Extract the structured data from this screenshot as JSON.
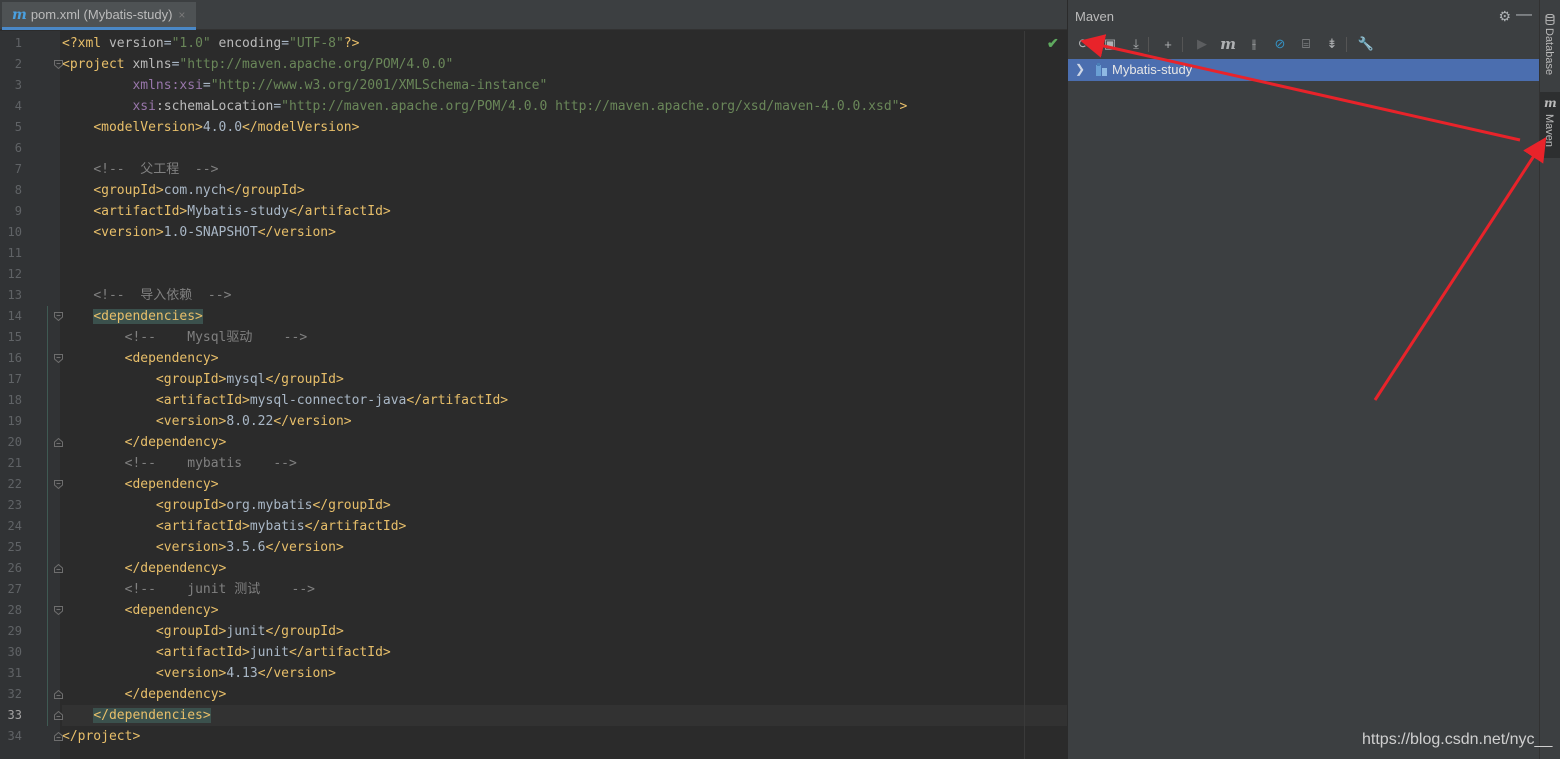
{
  "editor": {
    "tab": {
      "icon": "maven-m-icon",
      "label": "pom.xml (Mybatis-study)",
      "close": "×"
    },
    "current_line": 33,
    "lines": [
      [
        [
          "pi",
          "<?xml "
        ],
        [
          "at",
          "version"
        ],
        [
          "txt",
          "="
        ],
        [
          "av",
          "\"1.0\""
        ],
        [
          "at",
          " encoding"
        ],
        [
          "txt",
          "="
        ],
        [
          "av",
          "\"UTF-8\""
        ],
        [
          "pi",
          "?>"
        ]
      ],
      [
        [
          "tg",
          "<project "
        ],
        [
          "at",
          "xmlns"
        ],
        [
          "txt",
          "="
        ],
        [
          "av",
          "\"http://maven.apache.org/POM/4.0.0\""
        ]
      ],
      [
        [
          "txt",
          "         "
        ],
        [
          "ns",
          "xmlns:xsi"
        ],
        [
          "txt",
          "="
        ],
        [
          "av",
          "\"http://www.w3.org/2001/XMLSchema-instance\""
        ]
      ],
      [
        [
          "txt",
          "         "
        ],
        [
          "ns",
          "xsi"
        ],
        [
          "at",
          ":schemaLocation"
        ],
        [
          "txt",
          "="
        ],
        [
          "av",
          "\"http://maven.apache.org/POM/4.0.0 http://maven.apache.org/xsd/maven-4.0.0.xsd\""
        ],
        [
          "tg",
          ">"
        ]
      ],
      [
        [
          "txt",
          "    "
        ],
        [
          "tg",
          "<modelVersion>"
        ],
        [
          "txt",
          "4.0.0"
        ],
        [
          "tg",
          "</modelVersion>"
        ]
      ],
      [],
      [
        [
          "txt",
          "    "
        ],
        [
          "cm",
          "<!--  父工程  -->"
        ]
      ],
      [
        [
          "txt",
          "    "
        ],
        [
          "tg",
          "<groupId>"
        ],
        [
          "txt",
          "com.nych"
        ],
        [
          "tg",
          "</groupId>"
        ]
      ],
      [
        [
          "txt",
          "    "
        ],
        [
          "tg",
          "<artifactId>"
        ],
        [
          "txt",
          "Mybatis-study"
        ],
        [
          "tg",
          "</artifactId>"
        ]
      ],
      [
        [
          "txt",
          "    "
        ],
        [
          "tg",
          "<version>"
        ],
        [
          "txt",
          "1.0-SNAPSHOT"
        ],
        [
          "tg",
          "</version>"
        ]
      ],
      [],
      [],
      [
        [
          "txt",
          "    "
        ],
        [
          "cm",
          "<!--  导入依赖  -->"
        ]
      ],
      [
        [
          "txt",
          "    "
        ],
        [
          "tg hl",
          "<dependencies>"
        ]
      ],
      [
        [
          "txt",
          "        "
        ],
        [
          "cm",
          "<!--    Mysql驱动    -->"
        ]
      ],
      [
        [
          "txt",
          "        "
        ],
        [
          "tg",
          "<dependency>"
        ]
      ],
      [
        [
          "txt",
          "            "
        ],
        [
          "tg",
          "<groupId>"
        ],
        [
          "txt",
          "mysql"
        ],
        [
          "tg",
          "</groupId>"
        ]
      ],
      [
        [
          "txt",
          "            "
        ],
        [
          "tg",
          "<artifactId>"
        ],
        [
          "txt",
          "mysql-connector-java"
        ],
        [
          "tg",
          "</artifactId>"
        ]
      ],
      [
        [
          "txt",
          "            "
        ],
        [
          "tg",
          "<version>"
        ],
        [
          "txt",
          "8.0.22"
        ],
        [
          "tg",
          "</version>"
        ]
      ],
      [
        [
          "txt",
          "        "
        ],
        [
          "tg",
          "</dependency>"
        ]
      ],
      [
        [
          "txt",
          "        "
        ],
        [
          "cm",
          "<!--    mybatis    -->"
        ]
      ],
      [
        [
          "txt",
          "        "
        ],
        [
          "tg",
          "<dependency>"
        ]
      ],
      [
        [
          "txt",
          "            "
        ],
        [
          "tg",
          "<groupId>"
        ],
        [
          "txt",
          "org.mybatis"
        ],
        [
          "tg",
          "</groupId>"
        ]
      ],
      [
        [
          "txt",
          "            "
        ],
        [
          "tg",
          "<artifactId>"
        ],
        [
          "txt",
          "mybatis"
        ],
        [
          "tg",
          "</artifactId>"
        ]
      ],
      [
        [
          "txt",
          "            "
        ],
        [
          "tg",
          "<version>"
        ],
        [
          "txt",
          "3.5.6"
        ],
        [
          "tg",
          "</version>"
        ]
      ],
      [
        [
          "txt",
          "        "
        ],
        [
          "tg",
          "</dependency>"
        ]
      ],
      [
        [
          "txt",
          "        "
        ],
        [
          "cm",
          "<!--    junit 测试    -->"
        ]
      ],
      [
        [
          "txt",
          "        "
        ],
        [
          "tg",
          "<dependency>"
        ]
      ],
      [
        [
          "txt",
          "            "
        ],
        [
          "tg",
          "<groupId>"
        ],
        [
          "txt",
          "junit"
        ],
        [
          "tg",
          "</groupId>"
        ]
      ],
      [
        [
          "txt",
          "            "
        ],
        [
          "tg",
          "<artifactId>"
        ],
        [
          "txt",
          "junit"
        ],
        [
          "tg",
          "</artifactId>"
        ]
      ],
      [
        [
          "txt",
          "            "
        ],
        [
          "tg",
          "<version>"
        ],
        [
          "txt",
          "4.13"
        ],
        [
          "tg",
          "</version>"
        ]
      ],
      [
        [
          "txt",
          "        "
        ],
        [
          "tg",
          "</dependency>"
        ]
      ],
      [
        [
          "txt",
          "    "
        ],
        [
          "tg hl",
          "</dependencies>"
        ]
      ],
      [
        [
          "tg",
          "</project>"
        ]
      ]
    ],
    "fold_markers": [
      {
        "line": 2,
        "kind": "open"
      },
      {
        "line": 14,
        "kind": "open"
      },
      {
        "line": 16,
        "kind": "open"
      },
      {
        "line": 20,
        "kind": "close"
      },
      {
        "line": 22,
        "kind": "open"
      },
      {
        "line": 26,
        "kind": "close"
      },
      {
        "line": 28,
        "kind": "open"
      },
      {
        "line": 32,
        "kind": "close"
      },
      {
        "line": 33,
        "kind": "close"
      },
      {
        "line": 34,
        "kind": "close"
      }
    ],
    "inspection_status": "check-icon"
  },
  "maven": {
    "title": "Maven",
    "settings_icon": "gear-icon",
    "minimize_icon": "minimize-icon",
    "toolbar": [
      {
        "icon": "reload-icon",
        "glyph": "⟳",
        "enabled": true
      },
      {
        "icon": "generate-sources-icon",
        "glyph": "▣",
        "enabled": true
      },
      {
        "icon": "download-icon",
        "glyph": "⤓",
        "enabled": true
      },
      {
        "icon": "add-icon",
        "glyph": "+",
        "enabled": true
      },
      {
        "icon": "run-icon",
        "glyph": "▶",
        "enabled": false
      },
      {
        "icon": "execute-goal-icon",
        "glyph": "m",
        "enabled": true
      },
      {
        "icon": "toggle-offline-icon",
        "glyph": "⫲",
        "enabled": true
      },
      {
        "icon": "skip-tests-icon",
        "glyph": "⊘",
        "enabled": true
      },
      {
        "icon": "show-dependencies-icon",
        "glyph": "⌸",
        "enabled": true
      },
      {
        "icon": "collapse-all-icon",
        "glyph": "⇟",
        "enabled": true
      },
      {
        "icon": "settings-wrench-icon",
        "glyph": "🔧",
        "enabled": true
      }
    ],
    "tree": [
      {
        "label": "Mybatis-study",
        "expanded": false,
        "selected": true
      }
    ]
  },
  "side_tabs": [
    {
      "label": "Database",
      "icon": "database-icon"
    },
    {
      "label": "Maven",
      "icon": "maven-m-icon",
      "active": true
    }
  ],
  "watermark": "https://blog.csdn.net/nyc__",
  "annotation_color": "#e8232a"
}
